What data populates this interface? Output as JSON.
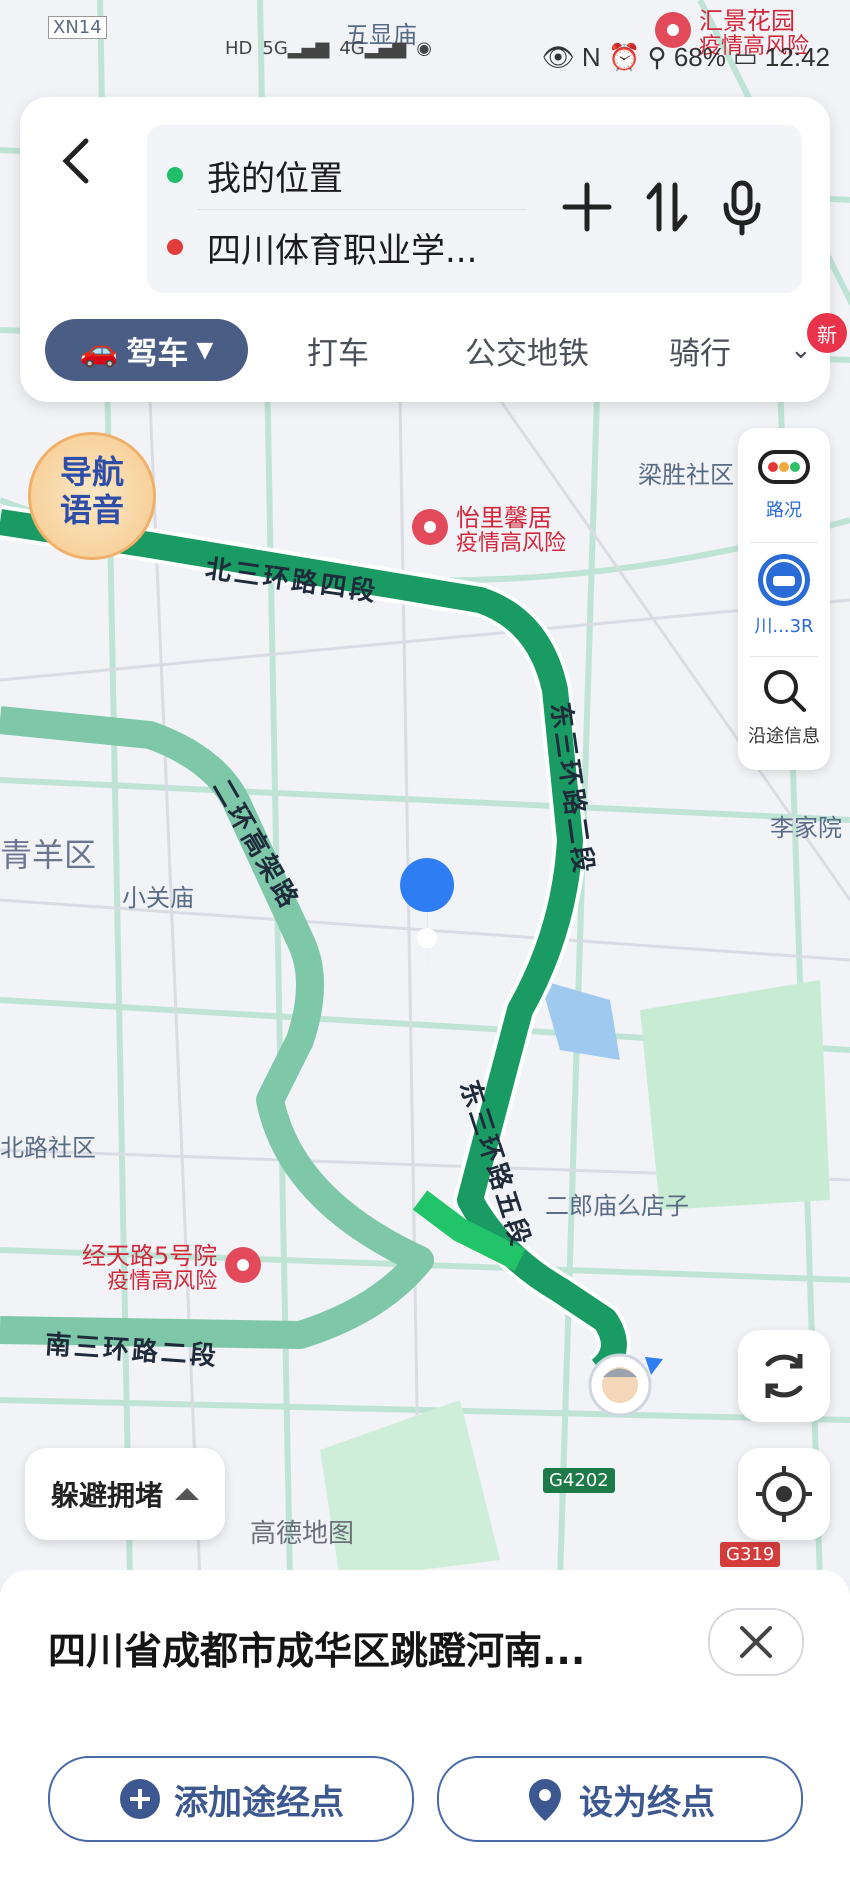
{
  "status_bar": {
    "battery": "68%",
    "time": "12:42",
    "icons": [
      "hd-icon",
      "5g-signal-icon",
      "4g-signal-icon",
      "wifi-icon",
      "eye-icon",
      "nfc-icon",
      "alarm-icon",
      "location-icon",
      "battery-icon"
    ]
  },
  "route": {
    "origin": "我的位置",
    "destination": "四川体育职业学...",
    "colors": {
      "origin": "#1fbf6a",
      "destination": "#e33b3b"
    }
  },
  "modes": {
    "drive": "驾车",
    "taxi": "打车",
    "transit": "公交地铁",
    "bike": "骑行",
    "new_badge": "新"
  },
  "side_tools": {
    "traffic": "路况",
    "plate": "川...3R",
    "along": "沿途信息"
  },
  "voice_badge": {
    "line1": "导航",
    "line2": "语音"
  },
  "map": {
    "places": {
      "wuxianmiao": "五显庙",
      "liangsheng": "梁胜社区",
      "qingyang": "青羊区",
      "xiaoguanmiao": "小关庙",
      "lijiayuan": "李家院",
      "beilu": "北路社区",
      "erlangmiao": "二郎庙么店子",
      "xn14": "XN14",
      "g4202": "G4202",
      "g319": "G319"
    },
    "roads": {
      "north": "北三环路四段",
      "east2": "东三环路二段",
      "east5": "东三环路五段",
      "ring1": "二环高架路",
      "south": "南三环路二段"
    },
    "risk_areas": [
      {
        "name": "汇景花园",
        "note": "疫情高风险"
      },
      {
        "name": "怡里馨居",
        "note": "疫情高风险"
      },
      {
        "name": "经天路5号院",
        "note": "疫情高风险"
      }
    ],
    "logo": "高德地图"
  },
  "buttons": {
    "avoid": "躲避拥堵"
  },
  "bottom_sheet": {
    "title": "四川省成都市成华区跳蹬河南...",
    "add_waypoint": "添加途经点",
    "set_destination": "设为终点"
  }
}
